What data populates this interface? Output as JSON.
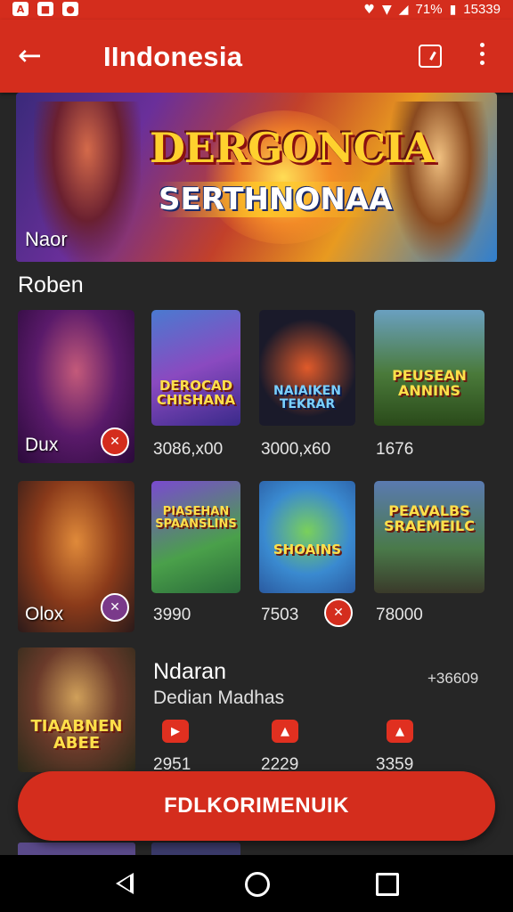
{
  "status_bar": {
    "left_icons": [
      "app-icon-a",
      "app-icon-b",
      "app-icon-c"
    ],
    "battery": "71%",
    "time": "15339"
  },
  "app_bar": {
    "title": "IIndonesia"
  },
  "banner": {
    "logo_line1": "DERGONCIA",
    "logo_line2": "SERTHNONAA",
    "label": "Naor"
  },
  "section": {
    "title": "Roben"
  },
  "grid_row1": [
    {
      "art_text": "",
      "label": "Dux",
      "badge": "✕"
    },
    {
      "art_text": "DEROCAD CHISHANA",
      "value": "3086,x00"
    },
    {
      "art_text": "NAIAIKEN TEKRAR",
      "value": "3000,x60"
    },
    {
      "art_text": "PEUSEAN ANNINS",
      "value": "1676"
    }
  ],
  "grid_row2": [
    {
      "art_text": "",
      "label": "Olox",
      "badge": "✕"
    },
    {
      "art_text": "PIASEHAN SPAANSLINS",
      "value": "3990"
    },
    {
      "art_text": "SHOAINS",
      "value": "7503"
    },
    {
      "art_text": "PEAVALBS SRAEMEILC",
      "value": "78000"
    }
  ],
  "list_item": {
    "art_text": "TIAABNEN ABEE",
    "title": "Ndaran",
    "subtitle": "Dedian Madhas",
    "count": "+36609",
    "stats": [
      "2951",
      "2229",
      "3359"
    ]
  },
  "cta": {
    "label": "FDLKORIMENUIK"
  },
  "colors": {
    "primary": "#d42d1d",
    "background": "#262626"
  }
}
